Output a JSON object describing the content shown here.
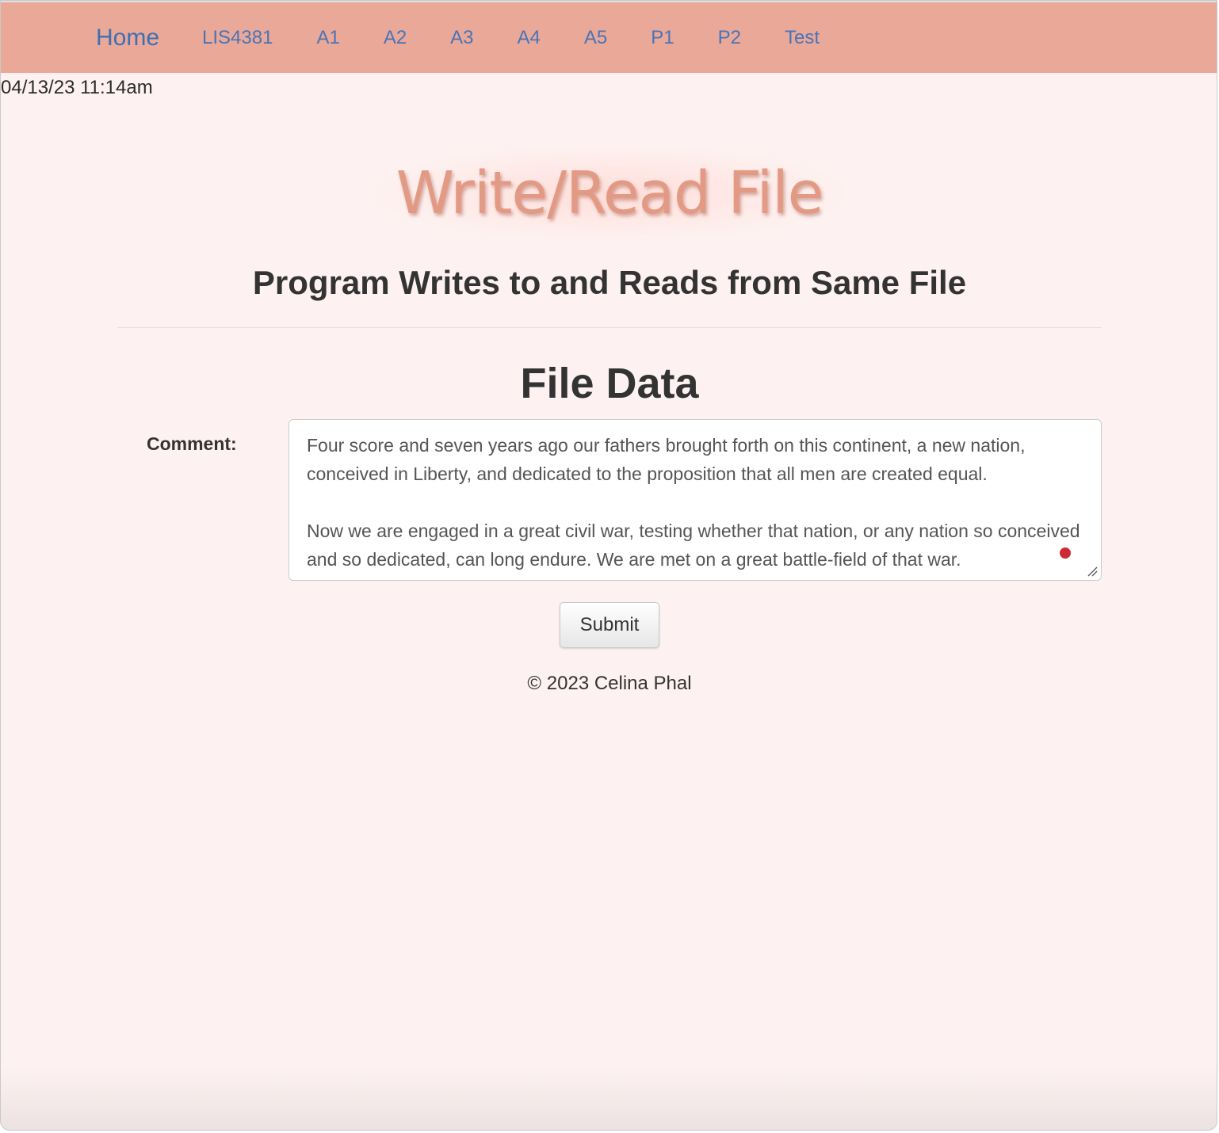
{
  "nav": {
    "brand": "Home",
    "items": [
      {
        "label": "LIS4381"
      },
      {
        "label": "A1"
      },
      {
        "label": "A2"
      },
      {
        "label": "A3"
      },
      {
        "label": "A4"
      },
      {
        "label": "A5"
      },
      {
        "label": "P1"
      },
      {
        "label": "P2"
      },
      {
        "label": "Test"
      }
    ]
  },
  "timestamp": "04/13/23 11:14am",
  "header": {
    "title": "Write/Read File",
    "subtitle": "Program Writes to and Reads from Same File"
  },
  "form": {
    "heading": "File Data",
    "comment_label": "Comment:",
    "comment_value": "Four score and seven years ago our fathers brought forth on this continent, a new nation, conceived in Liberty, and dedicated to the proposition that all men are created equal.\n\nNow we are engaged in a great civil war, testing whether that nation, or any nation so conceived and so dedicated, can long endure. We are met on a great battle-field of that war.",
    "submit_label": "Submit"
  },
  "footer": {
    "copyright": "© 2023 Celina Phal"
  },
  "colors": {
    "navbar_bg": "#eaa899",
    "page_bg": "#fdf2f1",
    "title": "#e39a84",
    "link": "#4a74b6"
  }
}
